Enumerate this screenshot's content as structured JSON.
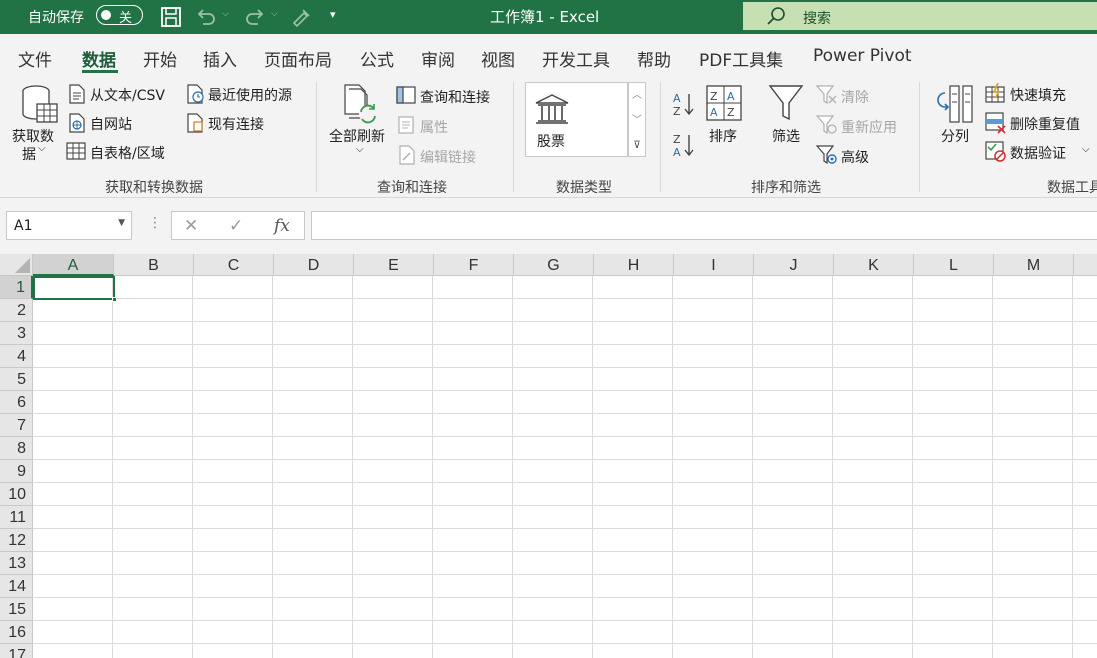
{
  "titlebar": {
    "autosave_label": "自动保存",
    "autosave_state": "关",
    "doc_title": "工作簿1  -  Excel",
    "search_label": "搜索"
  },
  "tabs": [
    {
      "label": "文件",
      "active": false
    },
    {
      "label": "数据",
      "active": true
    },
    {
      "label": "开始",
      "active": false
    },
    {
      "label": "插入",
      "active": false
    },
    {
      "label": "页面布局",
      "active": false
    },
    {
      "label": "公式",
      "active": false
    },
    {
      "label": "审阅",
      "active": false
    },
    {
      "label": "视图",
      "active": false
    },
    {
      "label": "开发工具",
      "active": false
    },
    {
      "label": "帮助",
      "active": false
    },
    {
      "label": "PDF工具集",
      "active": false
    },
    {
      "label": "Power Pivot",
      "active": false
    }
  ],
  "ribbon": {
    "get_data": {
      "get_data_line1": "获取数",
      "get_data_line2": "据",
      "from_text_csv": "从文本/CSV",
      "from_web": "自网站",
      "from_table": "自表格/区域",
      "recent_sources": "最近使用的源",
      "existing_connections": "现有连接",
      "group_label": "获取和转换数据"
    },
    "queries": {
      "refresh_all": "全部刷新",
      "queries_connections": "查询和连接",
      "properties": "属性",
      "edit_links": "编辑链接",
      "group_label": "查询和连接"
    },
    "data_types": {
      "stock": "股票",
      "group_label": "数据类型"
    },
    "sort_filter": {
      "sort": "排序",
      "filter": "筛选",
      "clear": "清除",
      "reapply": "重新应用",
      "advanced": "高级",
      "group_label": "排序和筛选"
    },
    "data_tools": {
      "text_to_columns": "分列",
      "flash_fill": "快速填充",
      "remove_duplicates": "删除重复值",
      "data_validation": "数据验证",
      "group_label": "数据工具"
    }
  },
  "formula_bar": {
    "name_box": "A1",
    "formula": ""
  },
  "sheet": {
    "columns": [
      "A",
      "B",
      "C",
      "D",
      "E",
      "F",
      "G",
      "H",
      "I",
      "J",
      "K",
      "L",
      "M"
    ],
    "rows": [
      "1",
      "2",
      "3",
      "4",
      "5",
      "6",
      "7",
      "8",
      "9",
      "10",
      "11",
      "12",
      "13",
      "14",
      "15",
      "16",
      "17"
    ],
    "active_cell": "A1"
  },
  "colors": {
    "accent": "#217346",
    "search_bg": "#c6e0b4"
  }
}
